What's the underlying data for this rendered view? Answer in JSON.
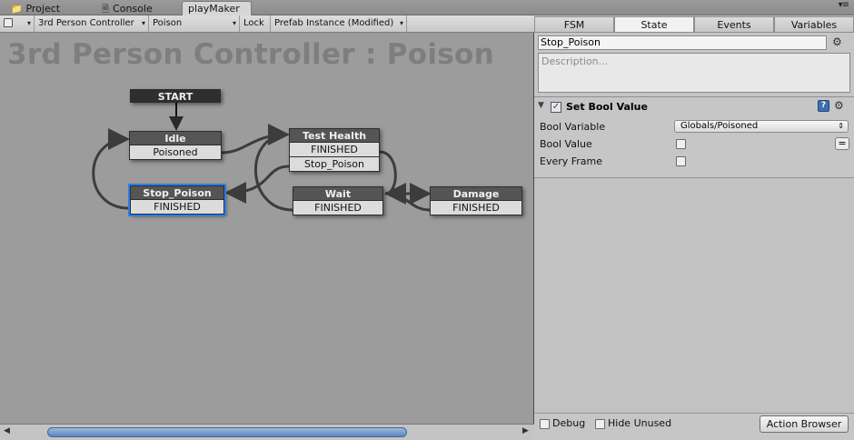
{
  "window_tabs": [
    {
      "label": "Project",
      "icon": "folder-icon"
    },
    {
      "label": "Console",
      "icon": "console-icon"
    },
    {
      "label": "playMaker",
      "icon": ""
    }
  ],
  "toolbar": {
    "object_select": "3rd Person Controller",
    "fsm_select": "Poison",
    "lock_label": "Lock",
    "prefab_select": "Prefab Instance (Modified)"
  },
  "canvas": {
    "title": "3rd Person Controller : Poison"
  },
  "graph": {
    "start_label": "START",
    "nodes": [
      {
        "id": "idle",
        "name": "Idle",
        "transitions": [
          "Poisoned"
        ]
      },
      {
        "id": "test-health",
        "name": "Test Health",
        "transitions": [
          "FINISHED",
          "Stop_Poison"
        ]
      },
      {
        "id": "stop-poison",
        "name": "Stop_Poison",
        "transitions": [
          "FINISHED"
        ],
        "selected": true
      },
      {
        "id": "wait",
        "name": "Wait",
        "transitions": [
          "FINISHED"
        ]
      },
      {
        "id": "damage",
        "name": "Damage",
        "transitions": [
          "FINISHED"
        ]
      }
    ]
  },
  "panel": {
    "tabs": [
      {
        "label": "FSM",
        "active": false
      },
      {
        "label": "State",
        "active": true
      },
      {
        "label": "Events",
        "active": false
      },
      {
        "label": "Variables",
        "active": false
      }
    ],
    "state_name": "Stop_Poison",
    "description_placeholder": "Description...",
    "action": {
      "title": "Set Bool Value",
      "enabled": true,
      "bool_variable_label": "Bool Variable",
      "bool_variable_value": "Globals/Poisoned",
      "bool_value_label": "Bool Value",
      "bool_value_checked": false,
      "every_frame_label": "Every Frame",
      "every_frame_checked": false
    },
    "footer": {
      "debug_label": "Debug",
      "hide_unused_label": "Hide Unused",
      "action_browser_label": "Action Browser"
    }
  },
  "colors": {
    "selection": "#2f7de0",
    "node_header": "#555555",
    "start_header": "#2e2e2e",
    "canvas": "#9c9c9c",
    "scroll_thumb": "#5a87bd"
  }
}
